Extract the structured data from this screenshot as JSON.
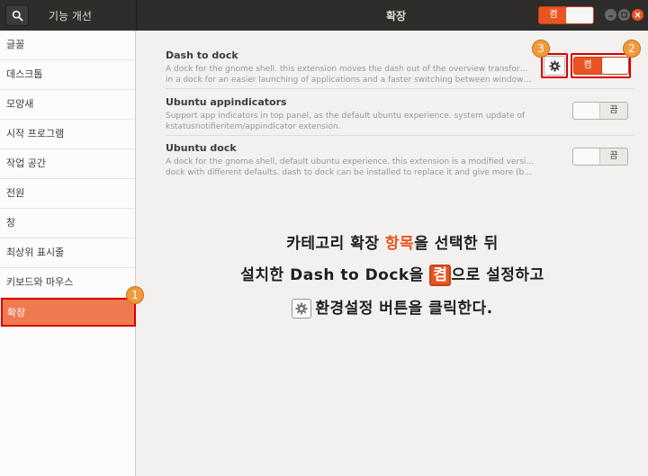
{
  "titlebar": {
    "app_title": "기능 개선",
    "window_title": "확장",
    "master_switch_label": "켬"
  },
  "sidebar": {
    "items": [
      {
        "label": "글꼴"
      },
      {
        "label": "데스크톱"
      },
      {
        "label": "모양새"
      },
      {
        "label": "시작 프로그램"
      },
      {
        "label": "작업 공간"
      },
      {
        "label": "전원"
      },
      {
        "label": "창"
      },
      {
        "label": "최상위 표시줄"
      },
      {
        "label": "키보드와 마우스"
      },
      {
        "label": "확장",
        "active": true
      }
    ]
  },
  "extensions": [
    {
      "name": "Dash to dock",
      "desc_line1": "A dock for the gnome shell. this extension moves the dash out of the overview transforming it",
      "desc_line2": "in a dock for an easier launching of applications and a faster switching between windows and ...",
      "switch_label": "켬",
      "enabled": true,
      "has_settings": true
    },
    {
      "name": "Ubuntu appindicators",
      "desc_line1": "Support app indicators in top panel, as the default ubuntu experience. system update of",
      "desc_line2": "kstatusnotifieritem/appindicator extension.",
      "switch_label": "끔",
      "enabled": false
    },
    {
      "name": "Ubuntu dock",
      "desc_line1": "A dock for the gnome shell, default ubuntu experience. this extension is a modified version of dash to",
      "desc_line2": "dock with different defaults. dash to dock can be installed to replace it and give more (but unsupport...",
      "switch_label": "끔",
      "enabled": false
    }
  ],
  "annotations": {
    "badge1": "1",
    "badge2": "2",
    "badge3": "3",
    "caption": {
      "line1_a": "카테고리 확장 ",
      "line1_hl": "항목",
      "line1_b": "을 선택한 뒤",
      "line2_a": "설치한 Dash to Dock을 ",
      "line2_on": "켬",
      "line2_b": "으로 설정하고",
      "line3": "환경설정 버튼을 클릭한다."
    }
  },
  "colors": {
    "accent": "#e95420",
    "annotation_red": "#d90000",
    "badge_orange": "#f09a3a",
    "titlebar_bg": "#2f2d2b",
    "active_row": "#f07a50"
  },
  "icons": {
    "search": "search-icon",
    "gear": "gear-icon",
    "minimize": "minimize-icon",
    "maximize": "maximize-icon",
    "close": "close-icon"
  }
}
